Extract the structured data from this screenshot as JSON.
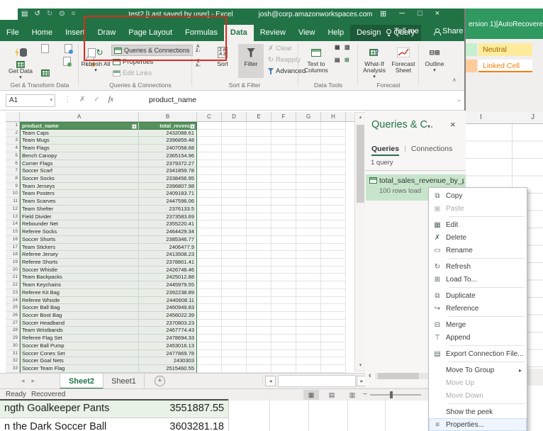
{
  "titlebar": {
    "title": "test2 [Last saved by user] - Excel",
    "account": "josh@corp.amazonworkspaces.com",
    "icons": {
      "save": "▤",
      "undo": "↺",
      "redo": "↻",
      "touch": "⊙",
      "customize": "≡",
      "restore": "⊞",
      "minimize": "─",
      "maximize": "□",
      "close": "×"
    }
  },
  "ribbon": {
    "tabs": [
      {
        "label": "File"
      },
      {
        "label": "Home"
      },
      {
        "label": "Insert"
      },
      {
        "label": "Draw"
      },
      {
        "label": "Page Layout"
      },
      {
        "label": "Formulas"
      },
      {
        "label": "Data",
        "active": true
      },
      {
        "label": "Review"
      },
      {
        "label": "View"
      },
      {
        "label": "Help"
      },
      {
        "label": "Design",
        "contextual": true
      },
      {
        "label": "Query",
        "contextual": true
      }
    ],
    "tell_me": "Tell me",
    "share": "Share",
    "buttons": {
      "get_data": "Get Data",
      "refresh_all": "Refresh All",
      "queries_connections": "Queries & Connections",
      "properties": "Properties",
      "edit_links": "Edit Links",
      "sort": "Sort",
      "filter": "Filter",
      "clear": "Clear",
      "reapply": "Reapply",
      "advanced": "Advanced",
      "text_to_columns": "Text to Columns",
      "what_if": "What-If Analysis",
      "forecast_sheet": "Forecast Sheet",
      "outline": "Outline"
    },
    "group_labels": {
      "get_transform": "Get & Transform Data",
      "queries": "Queries & Connections",
      "sort_filter": "Sort & Filter",
      "data_tools": "Data Tools",
      "forecast": "Forecast"
    }
  },
  "formula_bar": {
    "name_box": "A1",
    "fx": "fx",
    "content": "product_name"
  },
  "grid": {
    "column_headers": [
      "A",
      "B",
      "C",
      "D",
      "E",
      "F",
      "G",
      "H"
    ],
    "table": {
      "headers": [
        "product_name",
        "total_revenue"
      ],
      "rows": [
        [
          "Team Caps",
          "2432088.61"
        ],
        [
          "Team Mugs",
          "2396859.48"
        ],
        [
          "Team Flags",
          "2407058.68"
        ],
        [
          "Bench Canopy",
          "2365154.96"
        ],
        [
          "Corner Flags",
          "2379372.27"
        ],
        [
          "Soccer Scarf",
          "2341859.78"
        ],
        [
          "Soccer Socks",
          "2338456.95"
        ],
        [
          "Team Jerseys",
          "2396807.98"
        ],
        [
          "Team Posters",
          "2409183.71"
        ],
        [
          "Team Scarves",
          "2447596.06"
        ],
        [
          "Team Shelter",
          "2376133.5"
        ],
        [
          "Field Divider",
          "2373583.69"
        ],
        [
          "Rebounder Net",
          "2355220.41"
        ],
        [
          "Referee Socks",
          "2464429.34"
        ],
        [
          "Soccer Shorts",
          "2385346.77"
        ],
        [
          "Team Stickers",
          "2406477.9"
        ],
        [
          "Referee Jersey",
          "2413508.23"
        ],
        [
          "Referee Shorts",
          "2378801.41"
        ],
        [
          "Soccer Whistle",
          "2426748.46"
        ],
        [
          "Team Backpacks",
          "2425012.88"
        ],
        [
          "Team Keychains",
          "2445979.55"
        ],
        [
          "Referee Kit Bag",
          "2392238.89"
        ],
        [
          "Referee Whistle",
          "2440608.11"
        ],
        [
          "Soccer Ball Bag",
          "2460949.83"
        ],
        [
          "Soccer Boot Bag",
          "2456022.39"
        ],
        [
          "Soccer Headband",
          "2370803.23"
        ],
        [
          "Team Wristbands",
          "2467774.43"
        ],
        [
          "Referee Flag Set",
          "2478694.33"
        ],
        [
          "Soccer Ball Pump",
          "2453016.13"
        ],
        [
          "Soccer Cones Set",
          "2477869.78"
        ],
        [
          "Soccer Goal Nets",
          "2430303"
        ],
        [
          "Soccer Team Flag",
          "2515460.55"
        ]
      ]
    }
  },
  "queries_panel": {
    "title": "Queries & C..",
    "tabs": [
      "Queries",
      "Connections"
    ],
    "count_label": "1 query",
    "query_name": "total_sales_revenue_by_pro",
    "query_status": "100 rows load"
  },
  "context_menu": {
    "items": [
      {
        "label": "Copy",
        "icon": "copy-icon"
      },
      {
        "label": "Paste",
        "icon": "paste-icon",
        "disabled": true
      },
      {
        "sep": true
      },
      {
        "label": "Edit",
        "icon": "edit-icon"
      },
      {
        "label": "Delete",
        "icon": "delete-icon"
      },
      {
        "label": "Rename",
        "icon": "rename-icon"
      },
      {
        "sep": true
      },
      {
        "label": "Refresh",
        "icon": "refresh-icon"
      },
      {
        "label": "Load To...",
        "icon": "load-to-icon"
      },
      {
        "sep": true
      },
      {
        "label": "Duplicate",
        "icon": "duplicate-icon"
      },
      {
        "label": "Reference",
        "icon": "reference-icon"
      },
      {
        "sep": true
      },
      {
        "label": "Merge",
        "icon": "merge-icon"
      },
      {
        "label": "Append",
        "icon": "append-icon"
      },
      {
        "sep": true
      },
      {
        "label": "Export Connection File...",
        "icon": "export-icon"
      },
      {
        "sep": true
      },
      {
        "label": "Move To Group",
        "submenu": true
      },
      {
        "label": "Move Up",
        "disabled": true
      },
      {
        "label": "Move Down",
        "disabled": true
      },
      {
        "sep": true
      },
      {
        "label": "Show the peek"
      },
      {
        "label": "Properties...",
        "icon": "properties-icon",
        "hover": true
      }
    ]
  },
  "sheet_tabs": {
    "active": "Sheet2",
    "other": "Sheet1"
  },
  "status_bar": {
    "mode": "Ready",
    "recovered": "Recovered"
  },
  "background_window": {
    "title_fragment": "ersion 1)[AutoRecovere",
    "style_chips": {
      "neutral": "Neutral",
      "linked_cell": "Linked Cell"
    },
    "column_headers": [
      "I",
      "J"
    ],
    "bottom_rows": [
      {
        "name": "ngth Goalkeeper Pants",
        "value": "3551887.55"
      },
      {
        "name": "n the Dark Soccer Ball",
        "value": "3603281.18"
      }
    ]
  },
  "annotation": {
    "color": "#dd2b1c"
  }
}
